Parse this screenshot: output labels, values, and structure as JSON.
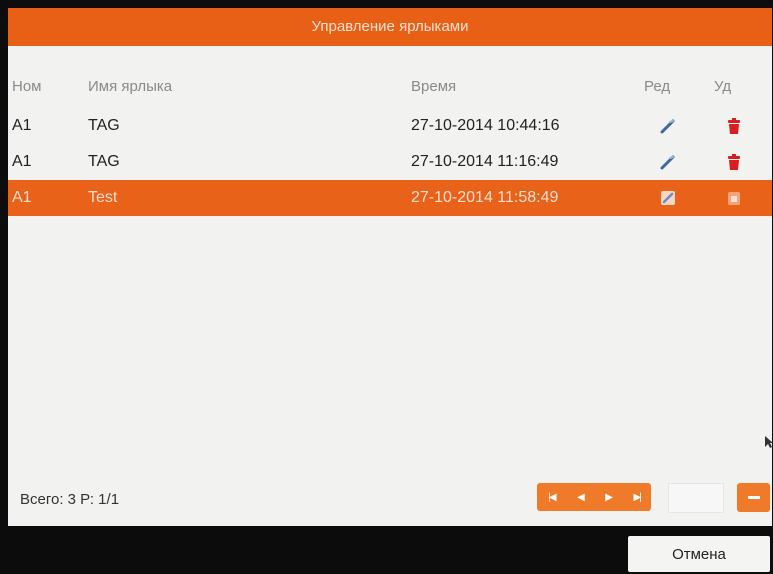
{
  "dialog": {
    "title": "Управление ярлыками"
  },
  "columns": {
    "num": "Ном",
    "name": "Имя ярлыка",
    "time": "Время",
    "edit": "Ред",
    "delete": "Уд"
  },
  "rows": [
    {
      "num": "A1",
      "name": "TAG",
      "time": "27-10-2014 10:44:16",
      "selected": false
    },
    {
      "num": "A1",
      "name": "TAG",
      "time": "27-10-2014 11:16:49",
      "selected": false
    },
    {
      "num": "A1",
      "name": "Test",
      "time": "27-10-2014 11:58:49",
      "selected": true
    }
  ],
  "footer": {
    "total": "Всего: 3 Р: 1/1",
    "cancel_label": "Отмена"
  },
  "icons": {
    "edit": "pencil-icon",
    "delete": "trash-icon",
    "first": "first-page-icon",
    "prev": "prev-page-icon",
    "next": "next-page-icon",
    "last": "last-page-icon",
    "go": "go-icon"
  },
  "colors": {
    "accent": "#e85f16",
    "delete": "#d81e1e",
    "edit": "#3f66a5"
  }
}
